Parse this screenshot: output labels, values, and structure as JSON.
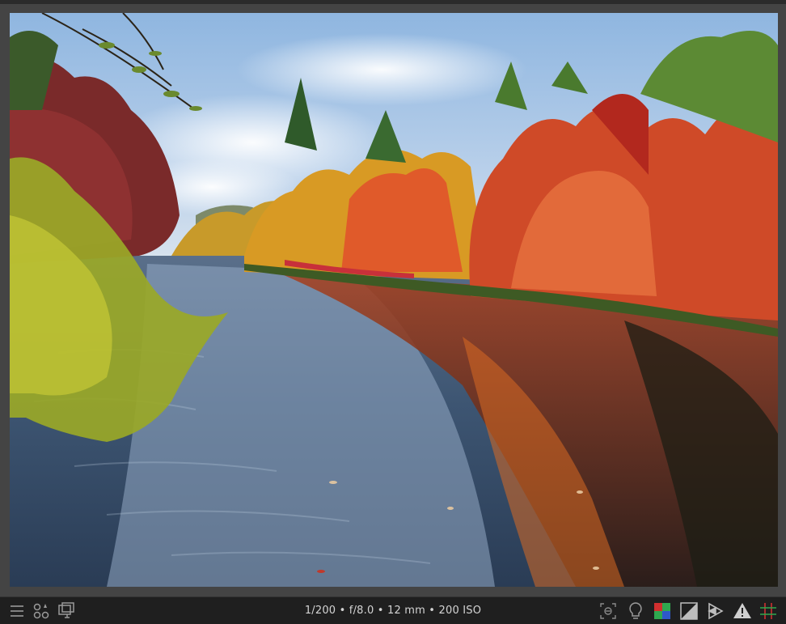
{
  "viewer": {
    "exif_text": "1/200 • f/8.0 • 12 mm • 200 ISO"
  },
  "toolbar_left": {
    "icons": [
      "menu-icon",
      "filter-sort-icon",
      "display-icon"
    ]
  },
  "toolbar_right": {
    "icons": [
      "focus-peaking-icon",
      "lightbulb-icon",
      "color-assessment-icon",
      "exposure-icon",
      "softproof-icon",
      "gamut-warning-icon",
      "guides-icon"
    ]
  },
  "colors": {
    "bar_bg": "#1f1f1f",
    "viewer_bg": "#444444",
    "icon_gray": "#9a9a9a",
    "accent_red": "#d12f2f",
    "accent_green": "#2fa84f",
    "accent_blue": "#2f58c9"
  }
}
